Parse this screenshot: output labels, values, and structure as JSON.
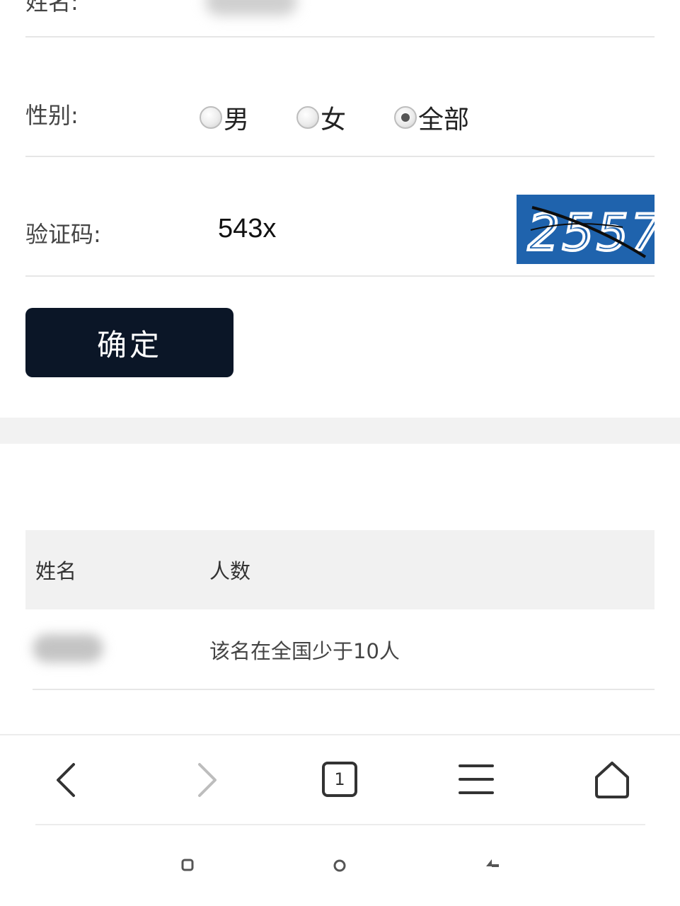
{
  "top_row": {
    "label": "姓名:"
  },
  "gender": {
    "label": "性别:",
    "options": [
      {
        "label": "男",
        "checked": false
      },
      {
        "label": "女",
        "checked": false
      },
      {
        "label": "全部",
        "checked": true
      }
    ]
  },
  "captcha": {
    "label": "验证码:",
    "input_value": "543x",
    "image_text": "2557"
  },
  "confirm_button": {
    "label": "确定"
  },
  "results_table": {
    "headers": [
      "姓名",
      "人数"
    ],
    "rows": [
      {
        "count_text": "该名在全国少于10人"
      }
    ]
  },
  "browser_nav": {
    "tab_count": "1"
  },
  "colors": {
    "button_bg": "#0b1627",
    "captcha_bg": "#1f63ad",
    "table_header_bg": "#f1f1f1"
  }
}
